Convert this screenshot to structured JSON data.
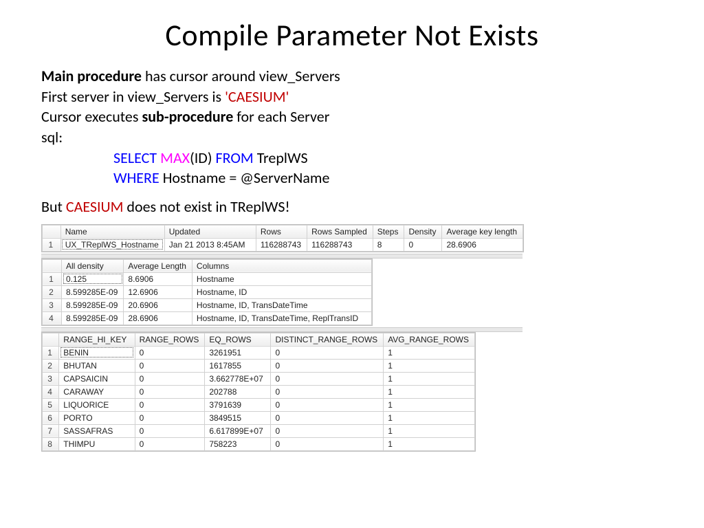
{
  "title": "Compile Parameter Not Exists",
  "lines": {
    "l1a": "Main procedure",
    "l1b": " has cursor around view_Servers",
    "l2a": "First server in view_Servers is ",
    "l2b": "'CAESIUM'",
    "l3a": "Cursor executes ",
    "l3b": "sub-procedure",
    "l3c": " for each Server",
    "l4": "sql:",
    "sql_select": "SELECT",
    "sql_max": " MAX",
    "sql_id": "(ID) ",
    "sql_from": "FROM",
    "sql_trepl": " TreplWS",
    "sql_where": "WHERE",
    "sql_host": " Hostname = @ServerName",
    "but1": "But ",
    "but2": "CAESIUM",
    "but3": " does not exist in TReplWS!"
  },
  "grid1": {
    "headers": [
      "Name",
      "Updated",
      "Rows",
      "Rows Sampled",
      "Steps",
      "Density",
      "Average key length"
    ],
    "rows": [
      [
        "1",
        "UX_TReplWS_Hostname",
        "Jan 21 2013  8:45AM",
        "116288743",
        "116288743",
        "8",
        "0",
        "28.6906"
      ]
    ]
  },
  "grid2": {
    "headers": [
      "All density",
      "Average Length",
      "Columns"
    ],
    "rows": [
      [
        "1",
        "0.125",
        "8.6906",
        "Hostname"
      ],
      [
        "2",
        "8.599285E-09",
        "12.6906",
        "Hostname, ID"
      ],
      [
        "3",
        "8.599285E-09",
        "20.6906",
        "Hostname, ID, TransDateTime"
      ],
      [
        "4",
        "8.599285E-09",
        "28.6906",
        "Hostname, ID, TransDateTime, ReplTransID"
      ]
    ]
  },
  "grid3": {
    "headers": [
      "RANGE_HI_KEY",
      "RANGE_ROWS",
      "EQ_ROWS",
      "DISTINCT_RANGE_ROWS",
      "AVG_RANGE_ROWS"
    ],
    "rows": [
      [
        "1",
        "BENIN",
        "0",
        "3261951",
        "0",
        "1"
      ],
      [
        "2",
        "BHUTAN",
        "0",
        "1617855",
        "0",
        "1"
      ],
      [
        "3",
        "CAPSAICIN",
        "0",
        "3.662778E+07",
        "0",
        "1"
      ],
      [
        "4",
        "CARAWAY",
        "0",
        "202788",
        "0",
        "1"
      ],
      [
        "5",
        "LIQUORICE",
        "0",
        "3791639",
        "0",
        "1"
      ],
      [
        "6",
        "PORTO",
        "0",
        "3849515",
        "0",
        "1"
      ],
      [
        "7",
        "SASSAFRAS",
        "0",
        "6.617899E+07",
        "0",
        "1"
      ],
      [
        "8",
        "THIMPU",
        "0",
        "758223",
        "0",
        "1"
      ]
    ]
  }
}
